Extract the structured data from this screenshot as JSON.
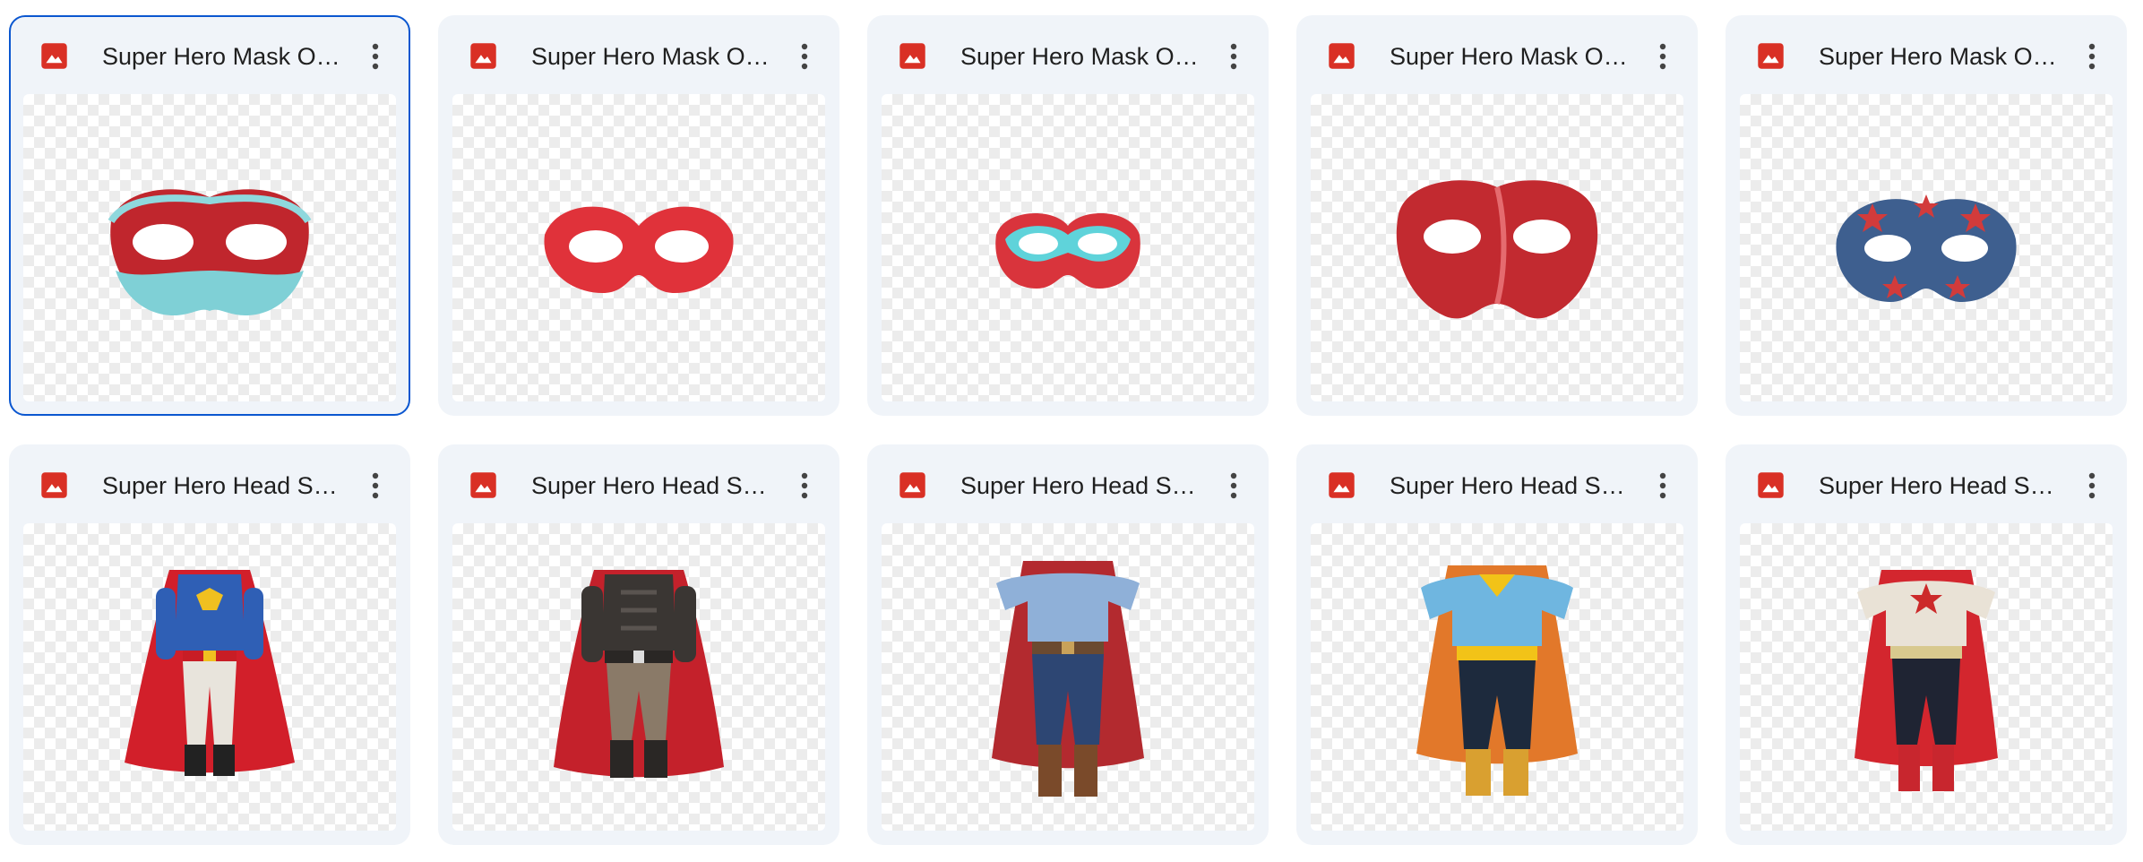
{
  "files": [
    {
      "title": "Super Hero Mask Overlay",
      "icon": "image-file-icon",
      "preview": "red-cyan-mask",
      "selected": true
    },
    {
      "title": "Super Hero Mask Overlay",
      "icon": "image-file-icon",
      "preview": "red-mask",
      "selected": false
    },
    {
      "title": "Super Hero Mask Overlay",
      "icon": "image-file-icon",
      "preview": "red-teal-mask",
      "selected": false
    },
    {
      "title": "Super Hero Mask Overlay",
      "icon": "image-file-icon",
      "preview": "red-full-mask",
      "selected": false
    },
    {
      "title": "Super Hero Mask Overlay",
      "icon": "image-file-icon",
      "preview": "blue-star-mask",
      "selected": false
    },
    {
      "title": "Super Hero Head Swap",
      "icon": "image-file-icon",
      "preview": "blue-suit-red-cape",
      "selected": false
    },
    {
      "title": "Super Hero Head Swap",
      "icon": "image-file-icon",
      "preview": "armored-suit-red-cape",
      "selected": false
    },
    {
      "title": "Super Hero Head Swap",
      "icon": "image-file-icon",
      "preview": "blue-shirt-red-cape",
      "selected": false
    },
    {
      "title": "Super Hero Head Swap",
      "icon": "image-file-icon",
      "preview": "cyan-yellow-suit-orange-cape",
      "selected": false
    },
    {
      "title": "Super Hero Head Swap",
      "icon": "image-file-icon",
      "preview": "star-shirt-red-cape",
      "selected": false
    }
  ],
  "colors": {
    "image_icon": "#d93025",
    "selected_border": "#0b57d0",
    "card_bg": "#f0f4f9"
  }
}
